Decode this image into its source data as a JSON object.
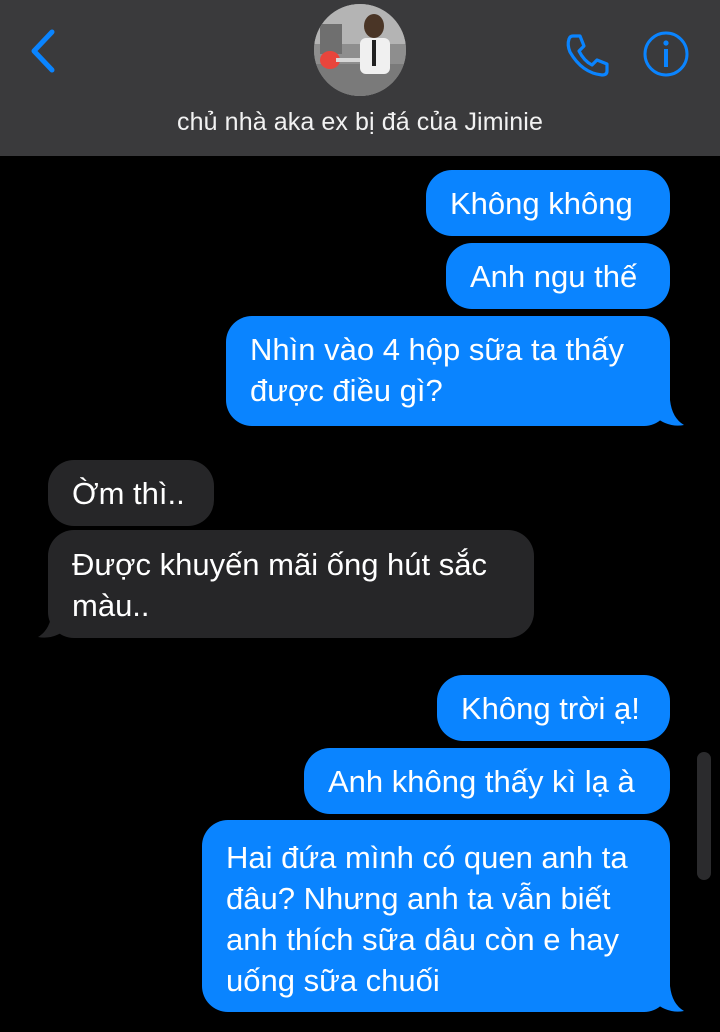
{
  "header": {
    "contact_name": "chủ nhà aka ex bị đá của Jiminie"
  },
  "colors": {
    "accent": "#0a84ff",
    "header_bg": "#3a3a3c",
    "sent_bubble": "#0a84ff",
    "received_bubble": "#262628",
    "background": "#000000"
  },
  "icons": {
    "back": "chevron-left-icon",
    "call": "phone-icon",
    "info": "info-icon"
  },
  "messages": [
    {
      "from": "me",
      "lines": [
        "Không không"
      ]
    },
    {
      "from": "me",
      "lines": [
        "Anh ngu thế"
      ]
    },
    {
      "from": "me",
      "lines": [
        "Nhìn vào 4 hộp sữa ta thấy",
        "được điều gì?"
      ]
    },
    {
      "from": "them",
      "lines": [
        "Ờm thì.."
      ]
    },
    {
      "from": "them",
      "lines": [
        "Được khuyến mãi ống hút sắc",
        "màu.."
      ]
    },
    {
      "from": "me",
      "lines": [
        "Không trời ạ!"
      ]
    },
    {
      "from": "me",
      "lines": [
        "Anh không thấy kì lạ à"
      ]
    },
    {
      "from": "me",
      "lines": [
        "Hai đứa mình có quen anh ta",
        "đâu? Nhưng anh ta vẫn biết",
        "anh thích sữa dâu còn e hay",
        "uống sữa chuối"
      ]
    }
  ]
}
